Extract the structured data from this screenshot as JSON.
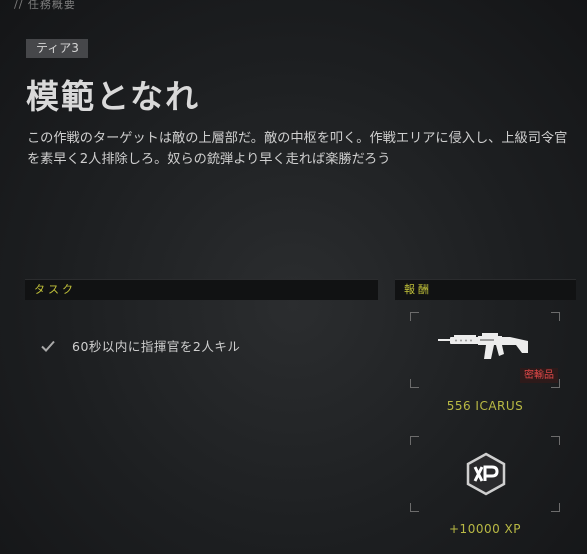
{
  "header": {
    "breadcrumb": "// 任務概要"
  },
  "mission": {
    "tier": "ティア3",
    "title": "模範となれ",
    "description": "この作戦のターゲットは敵の上層部だ。敵の中枢を叩く。作戦エリアに侵入し、上級司令官を素早く2人排除しろ。奴らの銃弾より早く走れば楽勝だろう"
  },
  "tasks": {
    "header": "タスク",
    "items": [
      {
        "label": "60秒以内に指揮官を2人キル",
        "icon": "check-icon"
      }
    ]
  },
  "rewards": {
    "header": "報酬",
    "items": [
      {
        "name": "556 ICARUS",
        "icon": "rifle-icon",
        "rarity": "密輸品",
        "rarity_color": "#e04848"
      },
      {
        "name": "+10000 XP",
        "icon": "xp-icon"
      }
    ]
  },
  "colors": {
    "accent": "#c2c23a",
    "reward_text": "#b9b944"
  }
}
